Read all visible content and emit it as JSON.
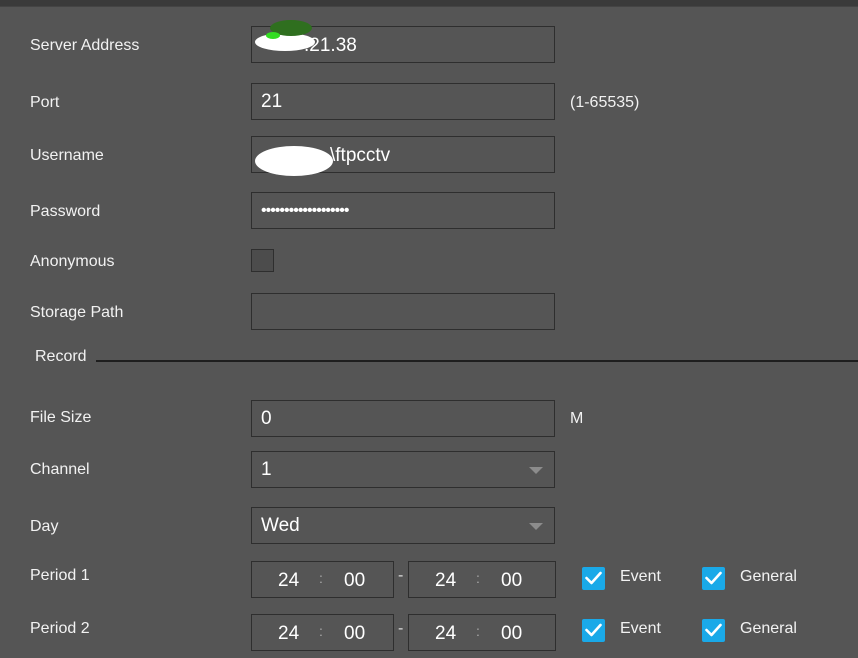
{
  "server_address": {
    "label": "Server Address",
    "value": ".21.38"
  },
  "port": {
    "label": "Port",
    "value": "21",
    "range_hint": "(1-65535)"
  },
  "username": {
    "label": "Username",
    "value": "\\ftpcctv"
  },
  "password": {
    "label": "Password",
    "value": "•••••••••••••••••••"
  },
  "anonymous": {
    "label": "Anonymous",
    "checked": false
  },
  "storage_path": {
    "label": "Storage Path",
    "value": ""
  },
  "record_section": {
    "title": "Record"
  },
  "file_size": {
    "label": "File Size",
    "value": "0",
    "unit": "M"
  },
  "channel": {
    "label": "Channel",
    "value": "1"
  },
  "day": {
    "label": "Day",
    "value": "Wed"
  },
  "periods": [
    {
      "label": "Period 1",
      "start_h": "24",
      "start_m": "00",
      "sep": ":",
      "dash": "-",
      "end_h": "24",
      "end_m": "00",
      "event_label": "Event",
      "event_checked": true,
      "general_label": "General",
      "general_checked": true
    },
    {
      "label": "Period 2",
      "start_h": "24",
      "start_m": "00",
      "sep": ":",
      "dash": "-",
      "end_h": "24",
      "end_m": "00",
      "event_label": "Event",
      "event_checked": true,
      "general_label": "General",
      "general_checked": true
    }
  ],
  "colors": {
    "background": "#555555",
    "checkbox_accent": "#1aa9e8",
    "border": "#2e2e2e"
  }
}
